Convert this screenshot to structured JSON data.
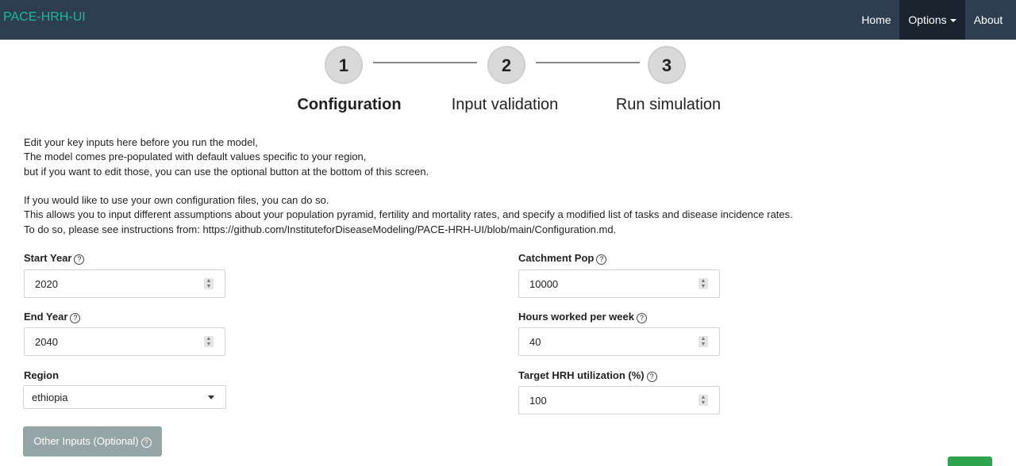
{
  "navbar": {
    "brand": "PACE-HRH-UI",
    "home": "Home",
    "options": "Options",
    "about": "About"
  },
  "steps": [
    {
      "number": "1",
      "label": "Configuration",
      "active": true
    },
    {
      "number": "2",
      "label": "Input validation",
      "active": false
    },
    {
      "number": "3",
      "label": "Run simulation",
      "active": false
    }
  ],
  "intro": {
    "lines": [
      "Edit your key inputs here before you run the model,",
      "The model comes pre-populated with default values specific to your region,",
      "but if you want to edit those, you can use the optional button at the bottom of this screen.",
      "",
      "If you would like to use your own configuration files, you can do so.",
      "This allows you to input different assumptions about your population pyramid, fertility and mortality rates, and specify a modified list of tasks and disease incidence rates.",
      "To do so, please see instructions from: https://github.com/InstituteforDiseaseModeling/PACE-HRH-UI/blob/main/Configuration.md."
    ]
  },
  "form": {
    "start_year": {
      "label": "Start Year",
      "value": "2020"
    },
    "end_year": {
      "label": "End Year",
      "value": "2040"
    },
    "region": {
      "label": "Region",
      "value": "ethiopia"
    },
    "catchment_pop": {
      "label": "Catchment Pop",
      "value": "10000"
    },
    "hours_per_week": {
      "label": "Hours worked per week",
      "value": "40"
    },
    "target_utilization": {
      "label": "Target HRH utilization (%)",
      "value": "100"
    }
  },
  "buttons": {
    "other_inputs": "Other Inputs (Optional)"
  },
  "icons": {
    "help": "?",
    "spinner_up": "▲",
    "spinner_down": "▼"
  },
  "colors": {
    "navbar": "#2c3e50",
    "brand": "#18bc9c",
    "active_nav": "#1a242f",
    "secondary_button": "#95a5a6",
    "primary_button": "#2ea44f"
  }
}
